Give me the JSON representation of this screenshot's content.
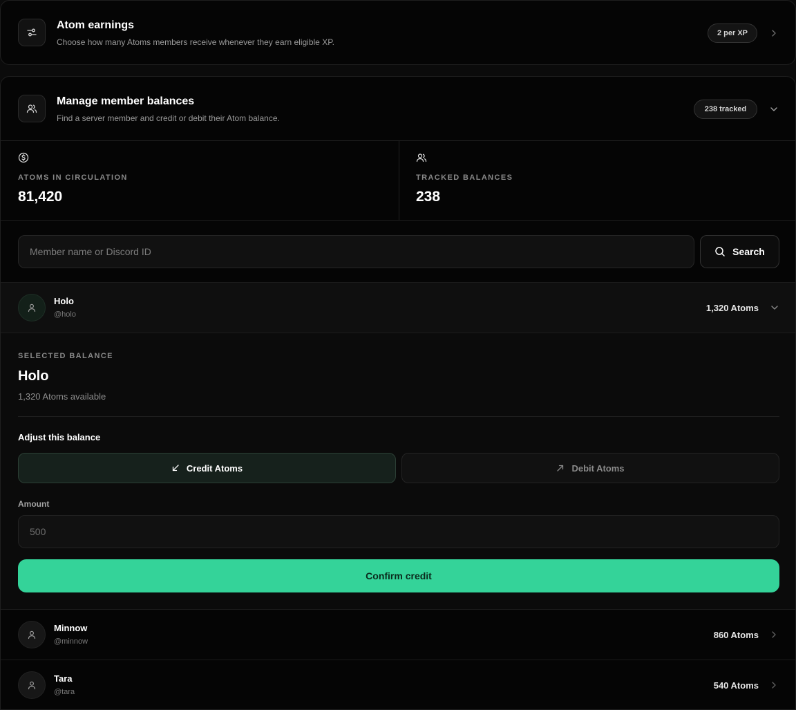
{
  "earnings": {
    "title": "Atom earnings",
    "subtitle": "Choose how many Atoms members receive whenever they earn eligible XP.",
    "badge": "2 per XP"
  },
  "balances": {
    "title": "Manage member balances",
    "subtitle": "Find a server member and credit or debit their Atom balance.",
    "badge": "238 tracked"
  },
  "stats": [
    {
      "label": "ATOMS IN CIRCULATION",
      "value": "81,420",
      "icon": "dollar-circle-icon"
    },
    {
      "label": "TRACKED BALANCES",
      "value": "238",
      "icon": "users-icon"
    }
  ],
  "search": {
    "placeholder": "Member name or Discord ID",
    "button_label": "Search"
  },
  "members": [
    {
      "name": "Holo",
      "handle": "@holo",
      "balance": "1,320 Atoms"
    },
    {
      "name": "Minnow",
      "handle": "@minnow",
      "balance": "860 Atoms"
    },
    {
      "name": "Tara",
      "handle": "@tara",
      "balance": "540 Atoms"
    }
  ],
  "selected": {
    "label": "SELECTED BALANCE",
    "name": "Holo",
    "available": "1,320 Atoms available",
    "adjust_label": "Adjust this balance",
    "credit_label": "Credit Atoms",
    "debit_label": "Debit Atoms",
    "amount_label": "Amount",
    "amount_placeholder": "500",
    "confirm_label": "Confirm credit"
  },
  "colors": {
    "accent": "#34d399",
    "background": "#050505",
    "border": "#1f1f1f"
  }
}
